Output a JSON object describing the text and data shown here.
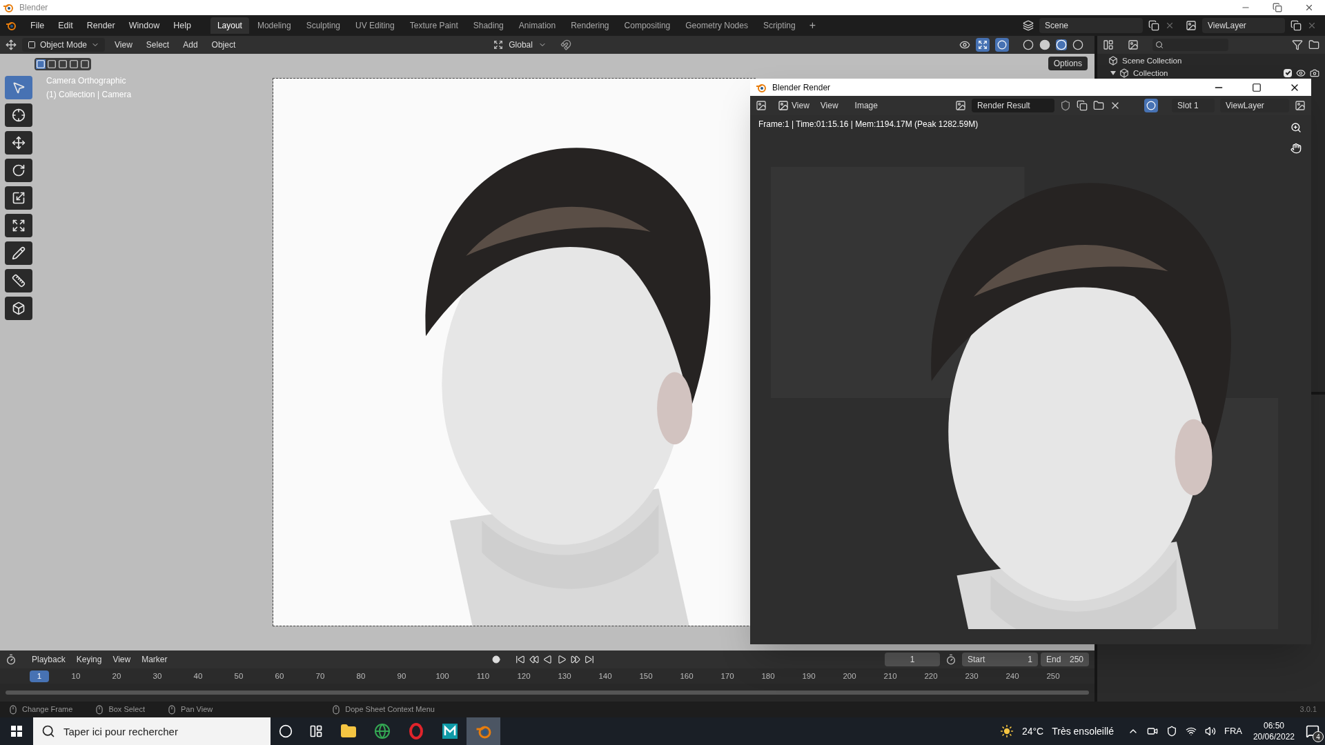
{
  "window": {
    "title": "Blender",
    "version": "3.0.1"
  },
  "menu": [
    "File",
    "Edit",
    "Render",
    "Window",
    "Help"
  ],
  "workspaces": [
    {
      "label": "Layout",
      "selected": true
    },
    {
      "label": "Modeling",
      "selected": false
    },
    {
      "label": "Sculpting",
      "selected": false
    },
    {
      "label": "UV Editing",
      "selected": false
    },
    {
      "label": "Texture Paint",
      "selected": false
    },
    {
      "label": "Shading",
      "selected": false
    },
    {
      "label": "Animation",
      "selected": false
    },
    {
      "label": "Rendering",
      "selected": false
    },
    {
      "label": "Compositing",
      "selected": false
    },
    {
      "label": "Geometry Nodes",
      "selected": false
    },
    {
      "label": "Scripting",
      "selected": false
    }
  ],
  "add_workspace": "+",
  "scene": {
    "name": "Scene",
    "view_layer": "ViewLayer"
  },
  "viewport_header": {
    "mode": "Object Mode",
    "menus": [
      "View",
      "Select",
      "Add",
      "Object"
    ],
    "orientation": "Global",
    "options": "Options"
  },
  "tools": [
    {
      "kind": "select",
      "selected": true
    },
    {
      "kind": "cursor",
      "selected": false
    },
    {
      "kind": "move",
      "selected": false
    },
    {
      "kind": "rotate",
      "selected": false
    },
    {
      "kind": "scale",
      "selected": false
    },
    {
      "kind": "transform",
      "selected": false
    },
    {
      "kind": "annotate",
      "selected": false
    },
    {
      "kind": "measure",
      "selected": false
    },
    {
      "kind": "add-cube",
      "selected": false
    }
  ],
  "viewport_overlay": [
    "Camera Orthographic",
    "(1) Collection | Camera"
  ],
  "outliner": {
    "root": "Scene Collection",
    "collections": [
      {
        "label": "Collection",
        "expanded": true,
        "checked": true
      }
    ]
  },
  "render_window": {
    "title": "Blender Render",
    "view_mode": "View",
    "menus": [
      "View",
      "Image"
    ],
    "image_name": "Render Result",
    "slot": "Slot 1",
    "view_layer": "ViewLayer",
    "info": "Frame:1 | Time:01:15.16 | Mem:1194.17M (Peak 1282.59M)"
  },
  "timeline": {
    "menus": [
      "Playback",
      "Keying",
      "View",
      "Marker"
    ],
    "current_frame": "1",
    "start_label": "Start",
    "start": "1",
    "end_label": "End",
    "end": "250",
    "ruler": [
      {
        "label": "1",
        "selected": true
      },
      {
        "label": "10",
        "selected": false
      },
      {
        "label": "20",
        "selected": false
      },
      {
        "label": "30",
        "selected": false
      },
      {
        "label": "40",
        "selected": false
      },
      {
        "label": "50",
        "selected": false
      },
      {
        "label": "60",
        "selected": false
      },
      {
        "label": "70",
        "selected": false
      },
      {
        "label": "80",
        "selected": false
      },
      {
        "label": "90",
        "selected": false
      },
      {
        "label": "100",
        "selected": false
      },
      {
        "label": "110",
        "selected": false
      },
      {
        "label": "120",
        "selected": false
      },
      {
        "label": "130",
        "selected": false
      },
      {
        "label": "140",
        "selected": false
      },
      {
        "label": "150",
        "selected": false
      },
      {
        "label": "160",
        "selected": false
      },
      {
        "label": "170",
        "selected": false
      },
      {
        "label": "180",
        "selected": false
      },
      {
        "label": "190",
        "selected": false
      },
      {
        "label": "200",
        "selected": false
      },
      {
        "label": "210",
        "selected": false
      },
      {
        "label": "220",
        "selected": false
      },
      {
        "label": "230",
        "selected": false
      },
      {
        "label": "240",
        "selected": false
      },
      {
        "label": "250",
        "selected": false
      }
    ]
  },
  "status_bar": [
    "Change Frame",
    "Box Select",
    "Pan View",
    "Dope Sheet Context Menu"
  ],
  "taskbar": {
    "search_placeholder": "Taper ici pour rechercher",
    "apps": [
      {
        "kind": "folder",
        "active": false
      },
      {
        "kind": "browser",
        "active": false
      },
      {
        "kind": "opera",
        "active": false
      },
      {
        "kind": "tile",
        "active": false
      },
      {
        "kind": "blender",
        "active": true
      }
    ],
    "temperature": "24°C",
    "weather": "Très ensoleillé",
    "language": "FRA",
    "time": "06:50",
    "date": "20/06/2022",
    "notifications": "4"
  }
}
